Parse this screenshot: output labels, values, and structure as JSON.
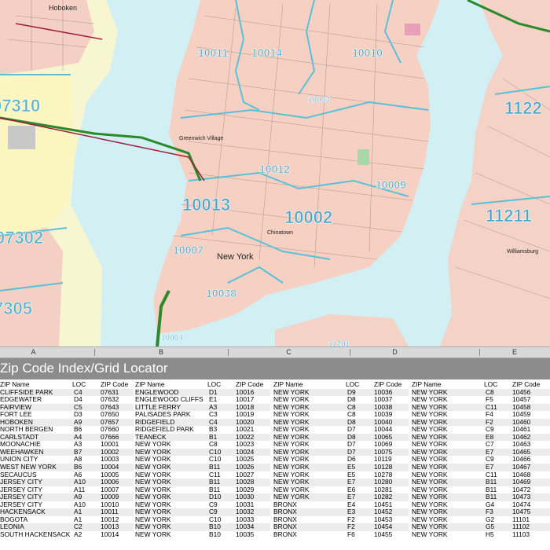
{
  "map": {
    "zip_labels": [
      {
        "text": "07310",
        "color": "#5ab4c8",
        "size": "big"
      },
      {
        "text": "07302",
        "color": "#5ab4c8",
        "size": "big"
      },
      {
        "text": "7305",
        "color": "#5ab4c8",
        "size": "big"
      },
      {
        "text": "10011",
        "color": "#4aa6c8",
        "size": "mid"
      },
      {
        "text": "10014",
        "color": "#4aa6c8",
        "size": "mid"
      },
      {
        "text": "10010",
        "color": "#4aa6c8",
        "size": "mid"
      },
      {
        "text": "10012",
        "color": "#4aa6c8",
        "size": "mid"
      },
      {
        "text": "10009",
        "color": "#4aa6c8",
        "size": "mid"
      },
      {
        "text": "10013",
        "color": "#4aa6c8",
        "size": "big"
      },
      {
        "text": "10002",
        "color": "#4aa6c8",
        "size": "big"
      },
      {
        "text": "10007",
        "color": "#4aa6c8",
        "size": "mid"
      },
      {
        "text": "10038",
        "color": "#4aa6c8",
        "size": "mid"
      },
      {
        "text": "1122",
        "color": "#4aa6c8",
        "size": "big"
      },
      {
        "text": "11211",
        "color": "#4aa6c8",
        "size": "big"
      },
      {
        "text": "11201",
        "color": "#4aa6c8",
        "size": "small"
      },
      {
        "text": "10004",
        "color": "#4aa6c8",
        "size": "small"
      },
      {
        "text": "10003",
        "color": "#4aa6c8",
        "size": "small"
      }
    ],
    "place_labels": [
      {
        "text": "Hoboken"
      },
      {
        "text": "Greenwich Village"
      },
      {
        "text": "New York"
      },
      {
        "text": "Chinatown"
      },
      {
        "text": "Williamsburg"
      }
    ]
  },
  "grid": {
    "columns": [
      "A",
      "B",
      "C",
      "D",
      "E"
    ]
  },
  "index": {
    "title": "Zip Code Index/Grid Locator",
    "headers": {
      "name": "ZIP Name",
      "loc": "LOC",
      "zip": "ZIP Code"
    },
    "col1": [
      [
        "CLIFFSIDE PARK",
        "C4",
        "07631"
      ],
      [
        "EDGEWATER",
        "D4",
        "07632"
      ],
      [
        "FAIRVIEW",
        "C5",
        "07643"
      ],
      [
        "FORT LEE",
        "D3",
        "07650"
      ],
      [
        "HOBOKEN",
        "A9",
        "07657"
      ],
      [
        "NORTH BERGEN",
        "B6",
        "07660"
      ],
      [
        "CARLSTADT",
        "A4",
        "07666"
      ],
      [
        "MOONACHIE",
        "A3",
        "10001"
      ],
      [
        "WEEHAWKEN",
        "B7",
        "10002"
      ],
      [
        "UNION CITY",
        "A8",
        "10003"
      ],
      [
        "WEST NEW YORK",
        "B6",
        "10004"
      ],
      [
        "SECAUCUS",
        "A6",
        "10005"
      ],
      [
        "JERSEY CITY",
        "A10",
        "10006"
      ],
      [
        "JERSEY CITY",
        "A11",
        "10007"
      ],
      [
        "JERSEY CITY",
        "A9",
        "10009"
      ],
      [
        "JERSEY CITY",
        "A10",
        "10010"
      ],
      [
        "HACKENSACK",
        "A1",
        "10011"
      ],
      [
        "BOGOTA",
        "A1",
        "10012"
      ],
      [
        "LEONIA",
        "C2",
        "10013"
      ],
      [
        "SOUTH HACKENSACK",
        "A2",
        "10014"
      ]
    ],
    "col2": [
      [
        "ENGLEWOOD",
        "D1",
        "10016"
      ],
      [
        "ENGLEWOOD CLIFFS",
        "E1",
        "10017"
      ],
      [
        "LITTLE FERRY",
        "A3",
        "10018"
      ],
      [
        "PALISADES PARK",
        "C3",
        "10019"
      ],
      [
        "RIDGEFIELD",
        "C4",
        "10020"
      ],
      [
        "RIDGEFIELD PARK",
        "B3",
        "10021"
      ],
      [
        "TEANECK",
        "B1",
        "10022"
      ],
      [
        "NEW YORK",
        "C8",
        "10023"
      ],
      [
        "NEW YORK",
        "C10",
        "10024"
      ],
      [
        "NEW YORK",
        "C10",
        "10025"
      ],
      [
        "NEW YORK",
        "B11",
        "10026"
      ],
      [
        "NEW YORK",
        "C11",
        "10027"
      ],
      [
        "NEW YORK",
        "B11",
        "10028"
      ],
      [
        "NEW YORK",
        "B11",
        "10029"
      ],
      [
        "NEW YORK",
        "D10",
        "10030"
      ],
      [
        "NEW YORK",
        "C9",
        "10031"
      ],
      [
        "NEW YORK",
        "C9",
        "10032"
      ],
      [
        "NEW YORK",
        "C10",
        "10033"
      ],
      [
        "NEW YORK",
        "B10",
        "10034"
      ],
      [
        "NEW YORK",
        "B10",
        "10035"
      ]
    ],
    "col3": [
      [
        "NEW YORK",
        "D9",
        "10036"
      ],
      [
        "NEW YORK",
        "D8",
        "10037"
      ],
      [
        "NEW YORK",
        "C8",
        "10038"
      ],
      [
        "NEW YORK",
        "C8",
        "10039"
      ],
      [
        "NEW YORK",
        "D8",
        "10040"
      ],
      [
        "NEW YORK",
        "D7",
        "10044"
      ],
      [
        "NEW YORK",
        "D8",
        "10065"
      ],
      [
        "NEW YORK",
        "D7",
        "10069"
      ],
      [
        "NEW YORK",
        "D7",
        "10075"
      ],
      [
        "NEW YORK",
        "D6",
        "10119"
      ],
      [
        "NEW YORK",
        "E5",
        "10128"
      ],
      [
        "NEW YORK",
        "E5",
        "10278"
      ],
      [
        "NEW YORK",
        "E7",
        "10280"
      ],
      [
        "NEW YORK",
        "E6",
        "10281"
      ],
      [
        "NEW YORK",
        "E7",
        "10282"
      ],
      [
        "BRONX",
        "E4",
        "10451"
      ],
      [
        "BRONX",
        "E3",
        "10452"
      ],
      [
        "BRONX",
        "F2",
        "10453"
      ],
      [
        "BRONX",
        "F2",
        "10454"
      ],
      [
        "BRONX",
        "F6",
        "10455"
      ]
    ],
    "col4": [
      [
        "",
        "C8",
        "10456"
      ],
      [
        "",
        "F5",
        "10457"
      ],
      [
        "",
        "C11",
        "10458"
      ],
      [
        "",
        "F4",
        "10459"
      ],
      [
        "",
        "F2",
        "10460"
      ],
      [
        "",
        "C9",
        "10461"
      ],
      [
        "",
        "E8",
        "10462"
      ],
      [
        "",
        "C7",
        "10463"
      ],
      [
        "",
        "E7",
        "10465"
      ],
      [
        "",
        "C9",
        "10466"
      ],
      [
        "",
        "E7",
        "10467"
      ],
      [
        "",
        "C11",
        "10468"
      ],
      [
        "",
        "B11",
        "10469"
      ],
      [
        "",
        "B11",
        "10472"
      ],
      [
        "",
        "B11",
        "10473"
      ],
      [
        "",
        "G4",
        "10474"
      ],
      [
        "",
        "F3",
        "10475"
      ],
      [
        "",
        "G2",
        "11101"
      ],
      [
        "",
        "G5",
        "11102"
      ],
      [
        "",
        "H5",
        "11103"
      ]
    ],
    "col4_names": [
      "NEW YORK",
      "NEW YORK",
      "NEW YORK",
      "NEW YORK",
      "NEW YORK",
      "NEW YORK",
      "NEW YORK",
      "NEW YORK",
      "NEW YORK",
      "NEW YORK",
      "NEW YORK",
      "NEW YORK",
      "NEW YORK",
      "NEW YORK",
      "NEW YORK",
      "NEW YORK",
      "NEW YORK",
      "NEW YORK",
      "NEW YORK",
      "NEW YORK"
    ]
  }
}
